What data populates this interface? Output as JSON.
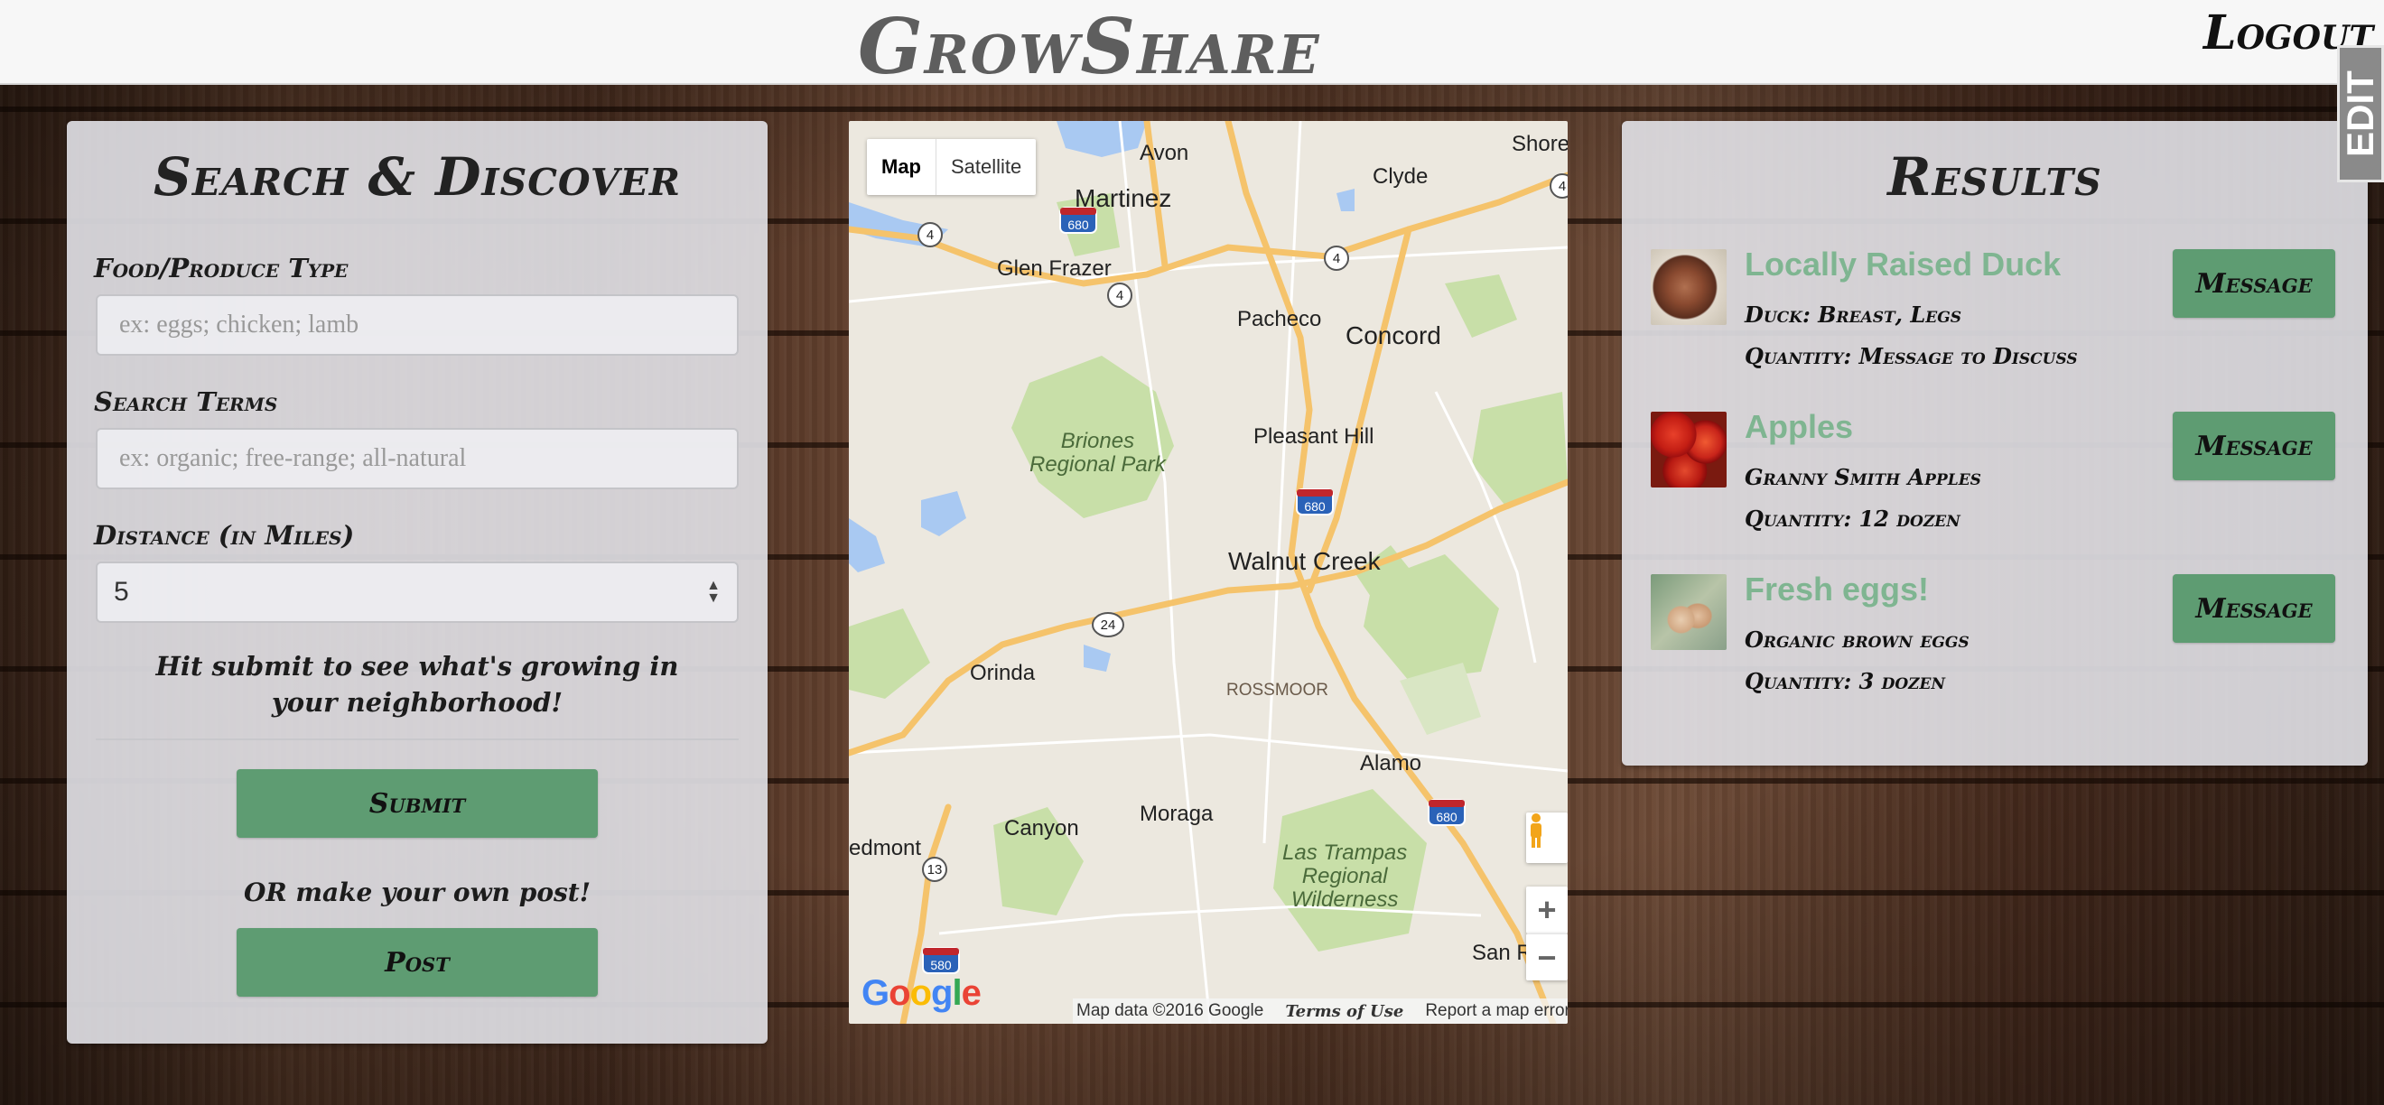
{
  "header": {
    "brand": "GrowShare",
    "logout_label": "Logout",
    "edit_tab_label": "EDIT"
  },
  "search": {
    "title": "Search & Discover",
    "food_label": "Food/Produce Type",
    "food_placeholder": "ex: eggs; chicken; lamb",
    "terms_label": "Search Terms",
    "terms_placeholder": "ex: organic; free-range; all-natural",
    "distance_label": "Distance (in Miles)",
    "distance_value": "5",
    "hint": "Hit submit to see what's growing in your neighborhood!",
    "submit_label": "Submit",
    "or_text": "OR make your own post!",
    "post_label": "Post"
  },
  "map": {
    "type_map": "Map",
    "type_satellite": "Satellite",
    "places": {
      "avon": "Avon",
      "clyde": "Clyde",
      "shore": "Shore",
      "martinez": "Martinez",
      "glen_frazer": "Glen Frazer",
      "pacheco": "Pacheco",
      "concord": "Concord",
      "briones": "Briones\nRegional Park",
      "pleasant_hill": "Pleasant Hill",
      "walnut_creek": "Walnut Creek",
      "orinda": "Orinda",
      "rossmoor": "ROSSMOOR",
      "alamo": "Alamo",
      "canyon": "Canyon",
      "moraga": "Moraga",
      "piedmont": "edmont",
      "las_trampas": "Las Trampas\nRegional\nWilderness",
      "san_ramon": "San Ram"
    },
    "shields": [
      "4",
      "4",
      "4",
      "4",
      "24",
      "13",
      "680",
      "680",
      "680",
      "580"
    ],
    "google": "Google",
    "map_data": "Map data ©2016 Google",
    "terms": "Terms of Use",
    "report": "Report a map error",
    "zoom_in": "+",
    "zoom_out": "−"
  },
  "results": {
    "title": "Results",
    "message_label": "Message",
    "items": [
      {
        "title": "Locally Raised Duck",
        "detail": "Duck: Breast, Legs",
        "quantity": "Quantity: Message to Discuss"
      },
      {
        "title": "Apples",
        "detail": "Granny Smith Apples",
        "quantity": "Quantity: 12 dozen"
      },
      {
        "title": "Fresh eggs!",
        "detail": "Organic brown eggs",
        "quantity": "Quantity: 3 dozen"
      }
    ]
  },
  "colors": {
    "accent_green": "#5e9c72",
    "result_title_green": "#7fb591",
    "panel_bg": "#e2e2e8"
  }
}
